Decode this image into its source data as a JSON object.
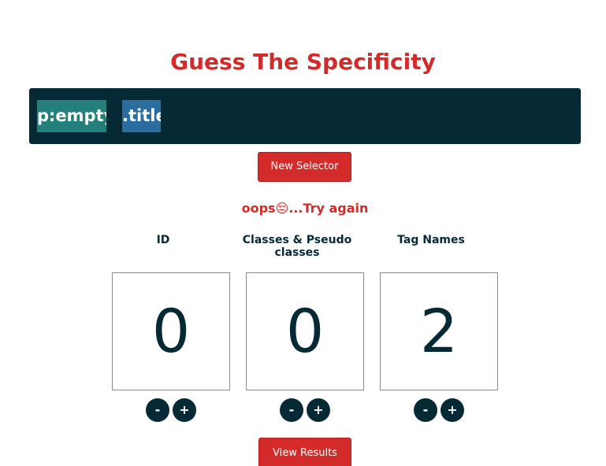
{
  "header": {
    "title": "Guess The Specificity"
  },
  "selector": {
    "parts": [
      {
        "text": "p:empty",
        "kind": "pseudo-class"
      },
      {
        "text": ".title",
        "kind": "class"
      }
    ]
  },
  "buttons": {
    "new_selector": "New Selector",
    "view_results": "View Results"
  },
  "feedback": {
    "message": "oops😔...Try again"
  },
  "columns": [
    {
      "label": "ID",
      "value": "0",
      "decrement": "-",
      "increment": "+"
    },
    {
      "label": "Classes & Pseudo classes",
      "value": "0",
      "decrement": "-",
      "increment": "+"
    },
    {
      "label": "Tag Names",
      "value": "2",
      "decrement": "-",
      "increment": "+"
    }
  ],
  "colors": {
    "accent_red": "#d32a2a",
    "dark_navy": "#062a35",
    "pseudo_chip": "#237f7a",
    "class_chip": "#2c6d9f"
  }
}
